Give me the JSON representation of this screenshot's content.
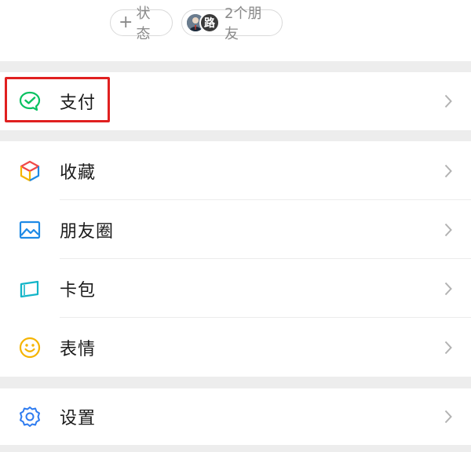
{
  "top": {
    "status_label": "状态",
    "friends_label": "2个朋友",
    "avatar_b_text": "路"
  },
  "menu": {
    "pay": "支付",
    "items": [
      {
        "label": "收藏"
      },
      {
        "label": "朋友圈"
      },
      {
        "label": "卡包"
      },
      {
        "label": "表情"
      }
    ],
    "settings": "设置"
  },
  "colors": {
    "pay_green": "#07c160",
    "highlight_red": "#e02020",
    "album_blue": "#1e8ae6",
    "card_cyan": "#13b5c8",
    "emoji_yellow": "#f5b400",
    "settings_blue": "#2f7cf0"
  },
  "icons": {
    "status": "plus-icon",
    "pay": "wechat-pay-icon",
    "favorites": "cube-icon",
    "moments": "image-icon",
    "cards": "card-wallet-icon",
    "stickers": "smiley-icon",
    "settings": "gear-icon",
    "chevron": "chevron-right-icon"
  }
}
